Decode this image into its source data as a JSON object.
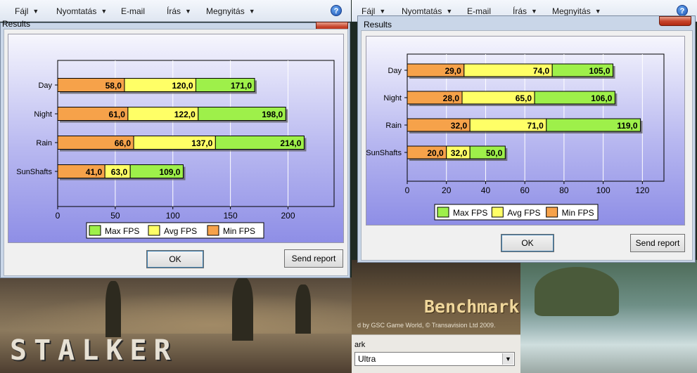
{
  "menu_bar": {
    "items": [
      {
        "label": "Fájl"
      },
      {
        "label": "Nyomtatás"
      },
      {
        "label": "E-mail"
      },
      {
        "label": "Írás"
      },
      {
        "label": "Megnyitás"
      }
    ],
    "help_glyph": "?"
  },
  "left_dialog": {
    "title": "Results",
    "ok_label": "OK",
    "send_label": "Send report"
  },
  "right_dialog": {
    "title": "Results",
    "ok_label": "OK",
    "send_label": "Send report"
  },
  "background": {
    "stalker_logo": "STALKER",
    "benchmark_label": "Benchmark",
    "copyright": "d by GSC Game World, © Transavision Ltd 2009.",
    "preset_label": "ark",
    "preset_value": "Ultra"
  },
  "colors": {
    "min": "#f6a24a",
    "avg": "#ffff66",
    "max": "#9ef04a"
  },
  "chart_data": [
    {
      "type": "bar",
      "orientation": "horizontal-stacked-overlay",
      "categories": [
        "Day",
        "Night",
        "Rain",
        "SunShafts"
      ],
      "series": [
        {
          "name": "Max FPS",
          "values": [
            171.0,
            198.0,
            214.0,
            109.0
          ]
        },
        {
          "name": "Avg FPS",
          "values": [
            120.0,
            122.0,
            137.0,
            63.0
          ]
        },
        {
          "name": "Min FPS",
          "values": [
            58.0,
            61.0,
            66.0,
            41.0
          ]
        }
      ],
      "value_labels": {
        "max": [
          "171,0",
          "198,0",
          "214,0",
          "109,0"
        ],
        "avg": [
          "120,0",
          "122,0",
          "137,0",
          "63,0"
        ],
        "min": [
          "58,0",
          "61,0",
          "66,0",
          "41,0"
        ]
      },
      "xticks": [
        "0",
        "50",
        "100",
        "150",
        "200"
      ],
      "xlim": [
        0,
        240
      ],
      "grid": true,
      "legend": "bottom"
    },
    {
      "type": "bar",
      "orientation": "horizontal-stacked-overlay",
      "categories": [
        "Day",
        "Night",
        "Rain",
        "SunShafts"
      ],
      "series": [
        {
          "name": "Max FPS",
          "values": [
            105.0,
            106.0,
            119.0,
            50.0
          ]
        },
        {
          "name": "Avg FPS",
          "values": [
            74.0,
            65.0,
            71.0,
            32.0
          ]
        },
        {
          "name": "Min FPS",
          "values": [
            29.0,
            28.0,
            32.0,
            20.0
          ]
        }
      ],
      "value_labels": {
        "max": [
          "105,0",
          "106,0",
          "119,0",
          "50,0"
        ],
        "avg": [
          "74,0",
          "65,0",
          "71,0",
          "32,0"
        ],
        "min": [
          "29,0",
          "28,0",
          "32,0",
          "20,0"
        ]
      },
      "xticks": [
        "0",
        "20",
        "40",
        "60",
        "80",
        "100",
        "120"
      ],
      "xlim": [
        0,
        131
      ],
      "grid": true,
      "legend": "bottom"
    }
  ]
}
